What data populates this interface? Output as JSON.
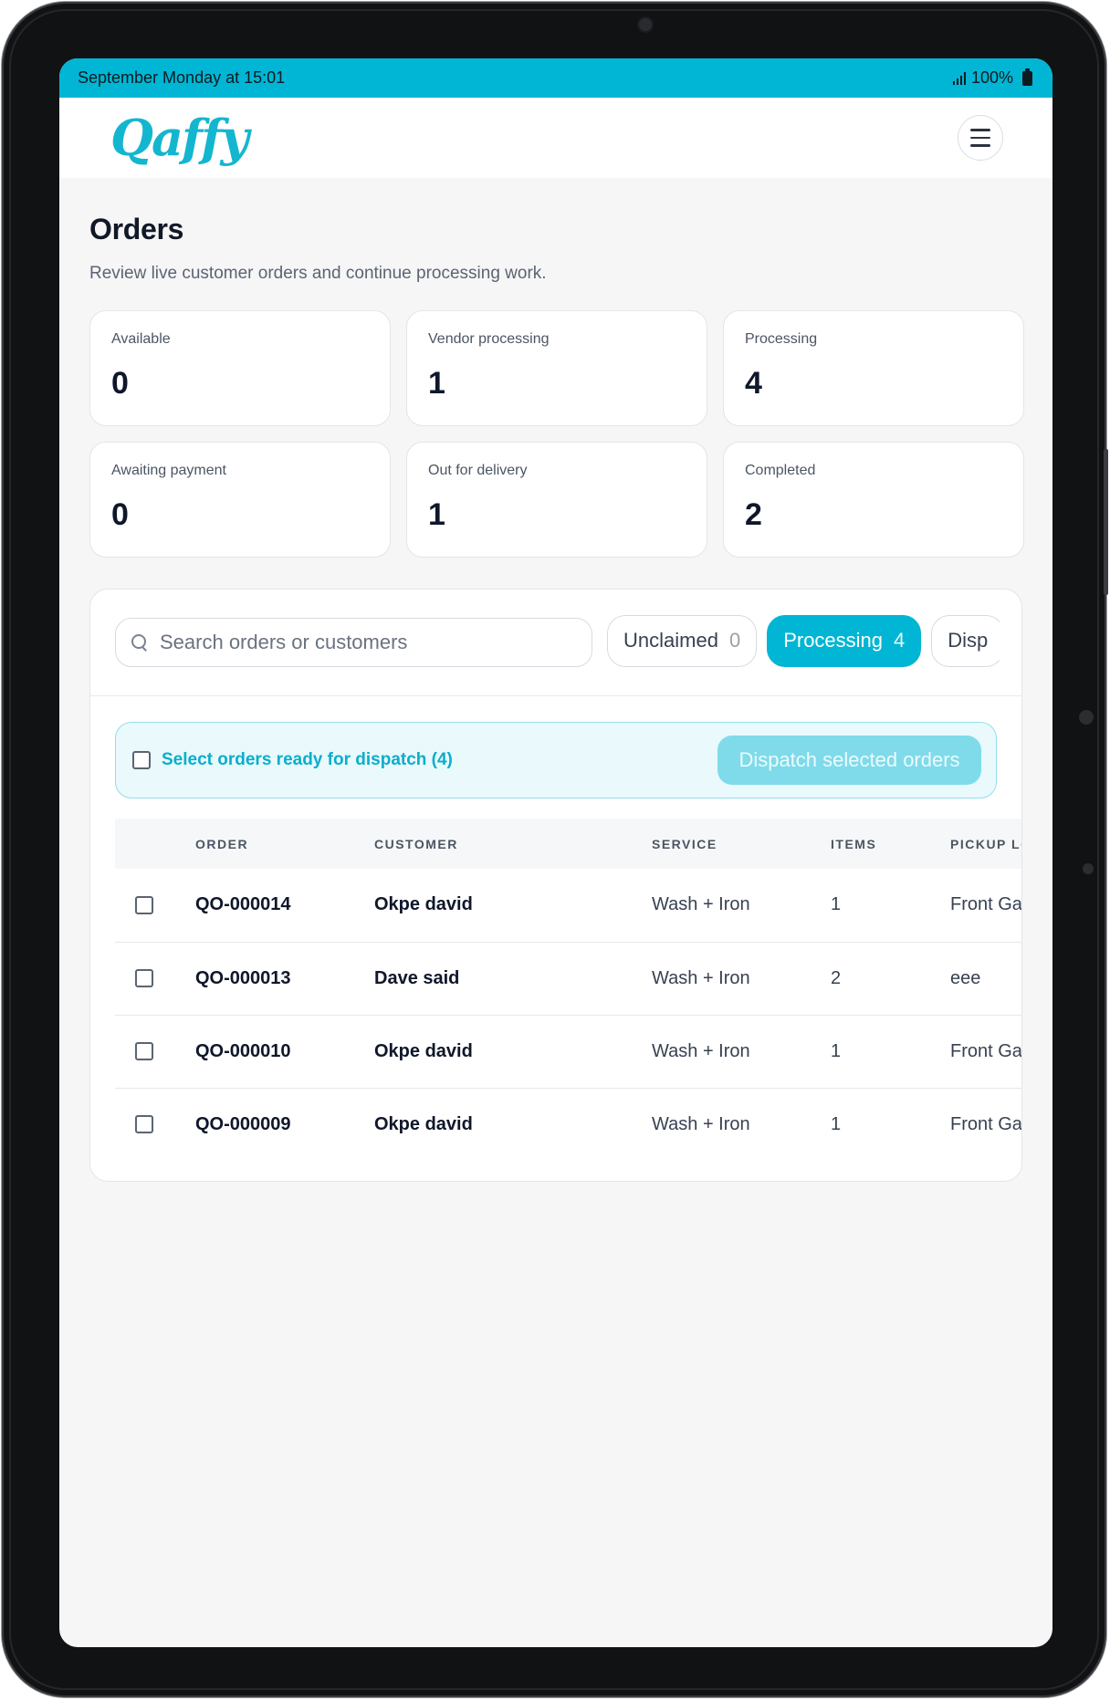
{
  "status_bar": {
    "time": "September Monday at 15:01",
    "battery": "100%"
  },
  "brand": {
    "logo_text": "Qaffy",
    "accent": "#00b6d4"
  },
  "page": {
    "title": "Orders",
    "subtitle": "Review live customer orders and continue processing work."
  },
  "stats": [
    {
      "label": "Available",
      "value": "0"
    },
    {
      "label": "Vendor processing",
      "value": "1"
    },
    {
      "label": "Processing",
      "value": "4"
    },
    {
      "label": "Awaiting payment",
      "value": "0"
    },
    {
      "label": "Out for delivery",
      "value": "1"
    },
    {
      "label": "Completed",
      "value": "2"
    }
  ],
  "search": {
    "placeholder": "Search orders or customers",
    "value": ""
  },
  "tabs": [
    {
      "label": "Unclaimed",
      "count": "0",
      "active": false
    },
    {
      "label": "Processing",
      "count": "4",
      "active": true
    },
    {
      "label": "Disp",
      "count": "",
      "active": false
    }
  ],
  "dispatch": {
    "select_label": "Select orders ready for dispatch (4)",
    "button_label": "Dispatch selected orders"
  },
  "table": {
    "headers": {
      "order": "ORDER",
      "customer": "CUSTOMER",
      "service": "SERVICE",
      "items": "ITEMS",
      "pickup": "PICKUP LO"
    },
    "rows": [
      {
        "order": "QO-000014",
        "customer": "Okpe david",
        "service": "Wash + Iron",
        "items": "1",
        "pickup": "Front Gat"
      },
      {
        "order": "QO-000013",
        "customer": "Dave said",
        "service": "Wash + Iron",
        "items": "2",
        "pickup": "eee"
      },
      {
        "order": "QO-000010",
        "customer": "Okpe david",
        "service": "Wash + Iron",
        "items": "1",
        "pickup": "Front Gat"
      },
      {
        "order": "QO-000009",
        "customer": "Okpe david",
        "service": "Wash + Iron",
        "items": "1",
        "pickup": "Front Gat"
      }
    ]
  }
}
